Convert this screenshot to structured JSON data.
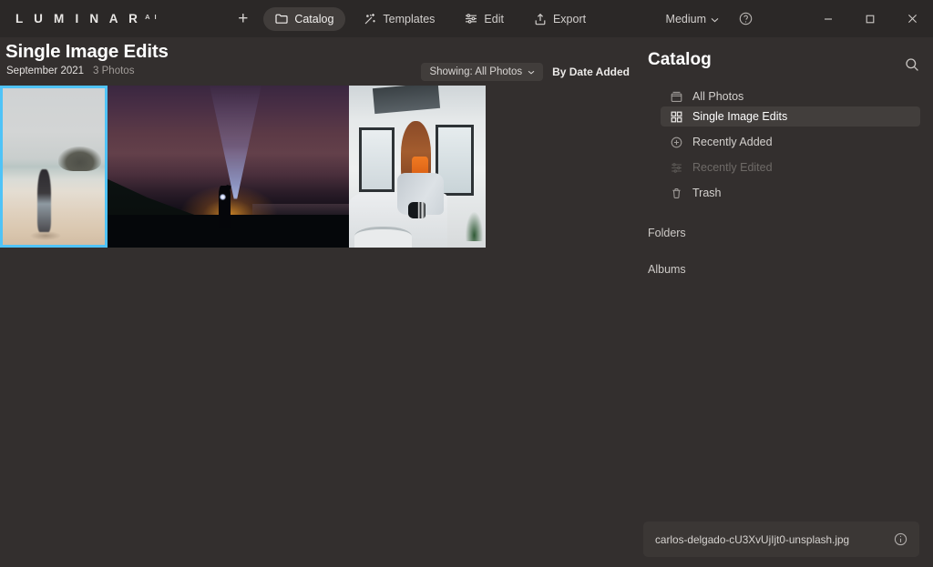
{
  "app": {
    "brand": "L U M I N A R",
    "brand_sup": "A I"
  },
  "toolbar": {
    "add_label": "+",
    "items": [
      {
        "label": "Catalog",
        "icon": "folder-icon",
        "active": true
      },
      {
        "label": "Templates",
        "icon": "templates-icon",
        "active": false
      },
      {
        "label": "Edit",
        "icon": "sliders-icon",
        "active": false
      },
      {
        "label": "Export",
        "icon": "export-icon",
        "active": false
      }
    ],
    "zoom_level": "Medium",
    "help_icon": "help-circle-icon",
    "window_controls": {
      "minimize": "–",
      "maximize": "□",
      "close": "✕"
    }
  },
  "header": {
    "title": "Single Image Edits",
    "date": "September 2021",
    "photo_count": "3 Photos",
    "showing_label": "Showing: All Photos",
    "sort_label": "By Date Added"
  },
  "grid": {
    "thumbnails": [
      {
        "name": "beach-walk-thumbnail",
        "selected": true
      },
      {
        "name": "night-sky-flashlight-thumbnail",
        "selected": false
      },
      {
        "name": "indoor-portrait-thumbnail",
        "selected": false
      }
    ]
  },
  "panel": {
    "title": "Catalog",
    "search_icon": "search-icon",
    "nav": [
      {
        "label": "All Photos",
        "icon": "photos-icon",
        "state": "normal"
      },
      {
        "label": "Single Image Edits",
        "icon": "grid-icon",
        "state": "active"
      },
      {
        "label": "Recently Added",
        "icon": "plus-circle-icon",
        "state": "normal"
      },
      {
        "label": "Recently Edited",
        "icon": "sliders-icon",
        "state": "disabled"
      },
      {
        "label": "Trash",
        "icon": "trash-icon",
        "state": "normal"
      }
    ],
    "sections": [
      {
        "label": "Folders"
      },
      {
        "label": "Albums"
      }
    ]
  },
  "filebar": {
    "filename": "carlos-delgado-cU3XvUjIjt0-unsplash.jpg",
    "info_icon": "info-circle-icon"
  },
  "colors": {
    "toolbar_bg": "#2b2827",
    "app_bg": "#332f2e",
    "selection": "#4fc3f7",
    "active_pill": "#423e3c"
  }
}
